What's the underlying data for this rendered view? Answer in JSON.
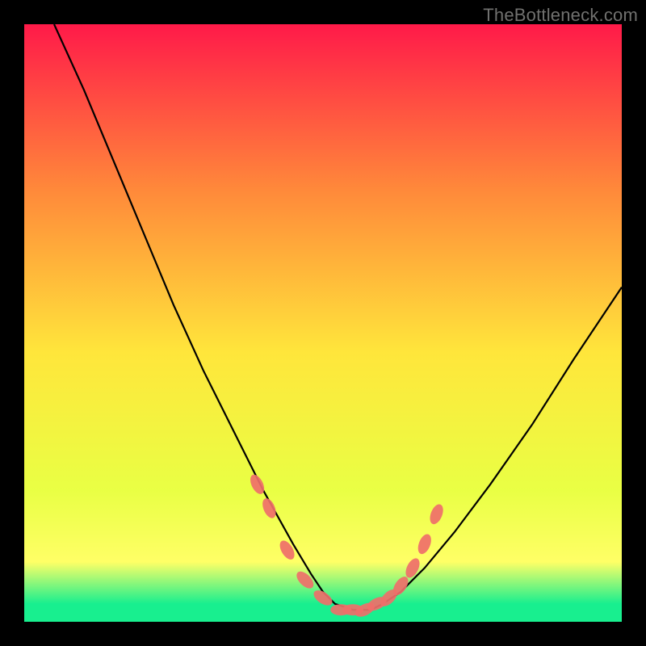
{
  "watermark": "TheBottleneck.com",
  "colors": {
    "bg": "#000000",
    "grad_top": "#ff1a49",
    "grad_mid_upper": "#ff8a3a",
    "grad_mid": "#ffe63b",
    "grad_low": "#e9ff44",
    "grad_bottom_yellow": "#ffff66",
    "grad_green": "#18ef8f",
    "curve": "#000000",
    "marker": "#ef6f6a"
  },
  "chart_data": {
    "type": "line",
    "title": "",
    "xlabel": "",
    "ylabel": "",
    "xlim": [
      0,
      100
    ],
    "ylim": [
      0,
      100
    ],
    "series": [
      {
        "name": "bottleneck-curve",
        "x": [
          5,
          10,
          15,
          20,
          25,
          30,
          35,
          40,
          45,
          48,
          50,
          52,
          55,
          58,
          60,
          63,
          67,
          72,
          78,
          85,
          92,
          100
        ],
        "y": [
          100,
          89,
          77,
          65,
          53,
          42,
          32,
          22,
          13,
          8,
          5,
          3,
          2,
          2,
          3,
          5,
          9,
          15,
          23,
          33,
          44,
          56
        ]
      }
    ],
    "markers": {
      "name": "highlighted-points",
      "x": [
        39,
        41,
        44,
        47,
        50,
        53,
        55,
        57,
        59,
        61,
        63,
        65,
        67,
        69
      ],
      "y": [
        23,
        19,
        12,
        7,
        4,
        2,
        2,
        2,
        3,
        4,
        6,
        9,
        13,
        18
      ]
    }
  }
}
